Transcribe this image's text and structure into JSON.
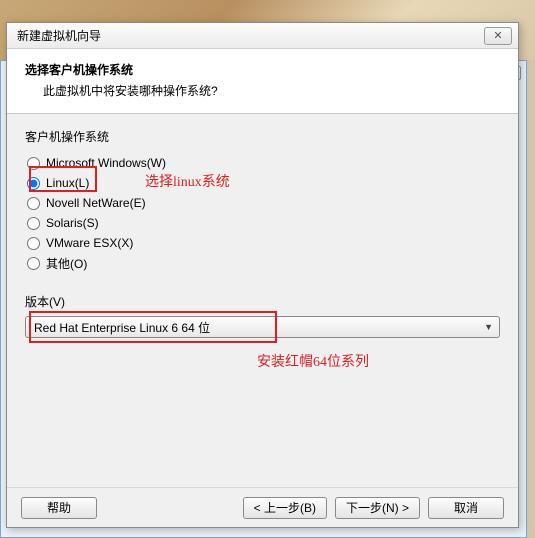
{
  "titlebar": {
    "title": "新建虚拟机向导",
    "close": "✕"
  },
  "header": {
    "title": "选择客户机操作系统",
    "subtitle": "此虚拟机中将安装哪种操作系统?"
  },
  "os_group": {
    "label": "客户机操作系统",
    "options": [
      {
        "label": "Microsoft Windows(W)",
        "selected": false
      },
      {
        "label": "Linux(L)",
        "selected": true
      },
      {
        "label": "Novell NetWare(E)",
        "selected": false
      },
      {
        "label": "Solaris(S)",
        "selected": false
      },
      {
        "label": "VMware ESX(X)",
        "selected": false
      },
      {
        "label": "其他(O)",
        "selected": false
      }
    ]
  },
  "version": {
    "label": "版本(V)",
    "selected": "Red Hat Enterprise Linux 6 64 位"
  },
  "annotations": {
    "a1": "选择linux系统",
    "a2": "安装红帽64位系列"
  },
  "footer": {
    "help": "帮助",
    "back": "< 上一步(B)",
    "next": "下一步(N) >",
    "cancel": "取消"
  },
  "bg": {
    "close": "✕"
  }
}
